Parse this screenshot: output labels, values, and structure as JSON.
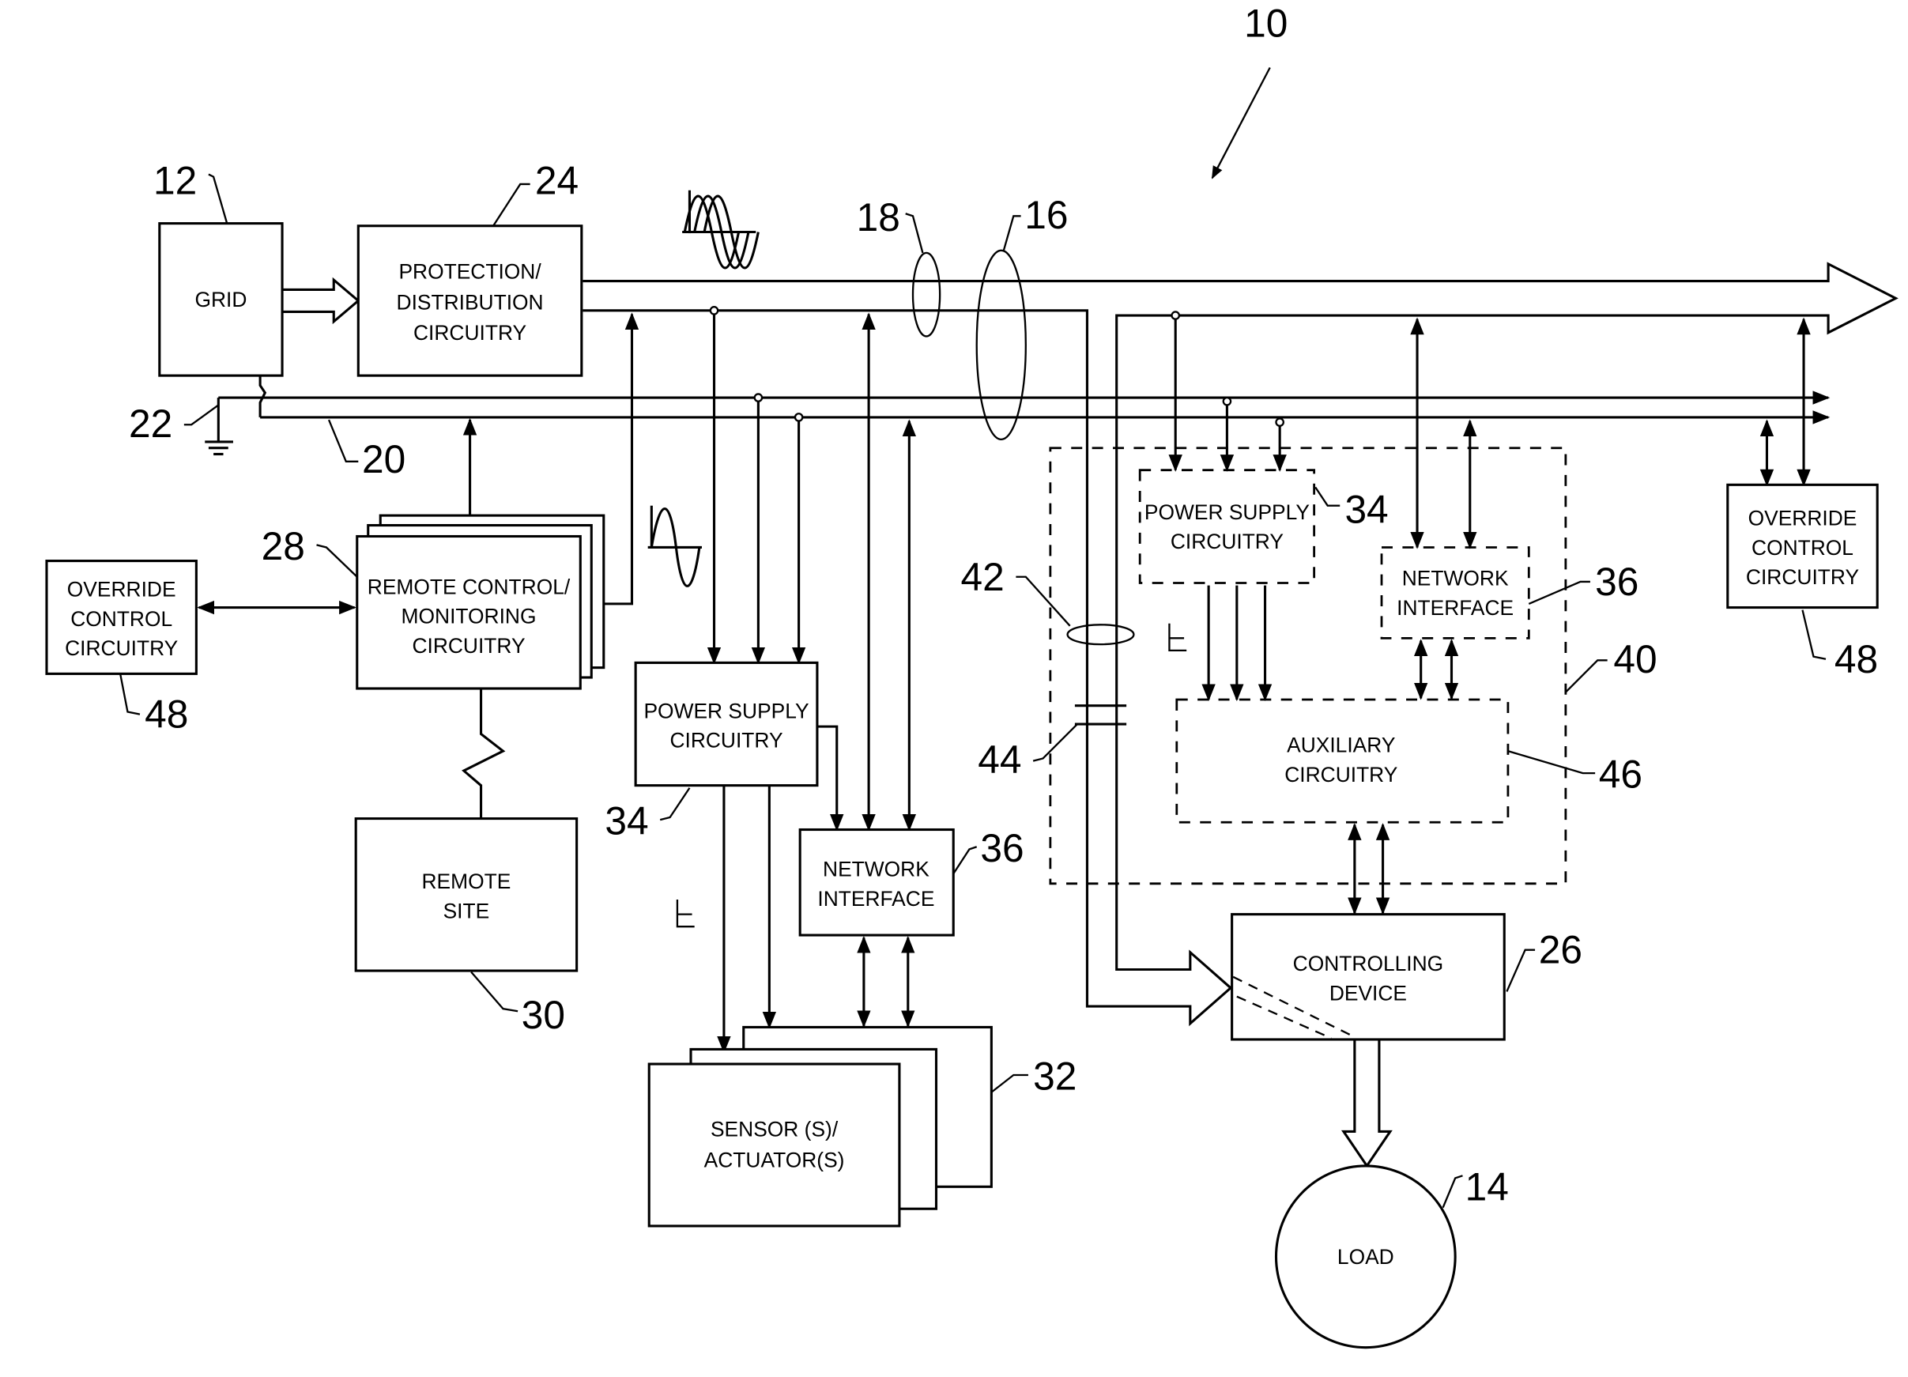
{
  "figure": {
    "ref": "10",
    "blocks": {
      "grid": {
        "ref": "12",
        "lines": [
          "GRID"
        ]
      },
      "protection": {
        "ref": "24",
        "lines": [
          "PROTECTION/",
          "DISTRIBUTION",
          "CIRCUITRY"
        ]
      },
      "remote_control": {
        "ref": "28",
        "lines": [
          "REMOTE CONTROL/",
          "MONITORING",
          "CIRCUITRY"
        ]
      },
      "override_left": {
        "ref": "48",
        "lines": [
          "OVERRIDE",
          "CONTROL",
          "CIRCUITRY"
        ]
      },
      "remote_site": {
        "ref": "30",
        "lines": [
          "REMOTE",
          "SITE"
        ]
      },
      "power_supply_left": {
        "ref": "34",
        "lines": [
          "POWER SUPPLY",
          "CIRCUITRY"
        ]
      },
      "network_left": {
        "ref": "36",
        "lines": [
          "NETWORK",
          "INTERFACE"
        ]
      },
      "sensors": {
        "ref": "32",
        "lines": [
          "SENSOR (S)/",
          "ACTUATOR(S)"
        ]
      },
      "power_supply_right": {
        "ref": "34",
        "lines": [
          "POWER SUPPLY",
          "CIRCUITRY"
        ]
      },
      "network_right": {
        "ref": "36",
        "lines": [
          "NETWORK",
          "INTERFACE"
        ]
      },
      "auxiliary": {
        "ref": "46",
        "lines": [
          "AUXILIARY",
          "CIRCUITRY"
        ]
      },
      "module": {
        "ref": "40"
      },
      "override_right": {
        "ref": "48",
        "lines": [
          "OVERRIDE",
          "CONTROL",
          "CIRCUITRY"
        ]
      },
      "controlling_device": {
        "ref": "26",
        "lines": [
          "CONTROLLING",
          "DEVICE"
        ]
      },
      "load": {
        "ref": "14",
        "lines": [
          "LOAD"
        ]
      }
    },
    "refs": {
      "power_conductors": "16",
      "data_conductors": "18",
      "data_bus": "20",
      "ground": "22",
      "current_sensor": "42",
      "contact": "44"
    }
  }
}
